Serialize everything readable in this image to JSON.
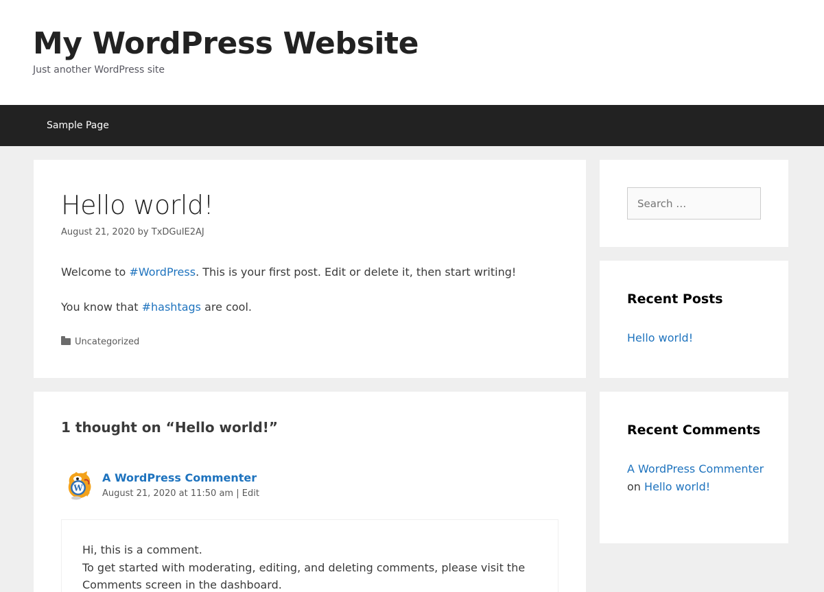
{
  "header": {
    "site_title": "My WordPress Website",
    "tagline": "Just another WordPress site"
  },
  "nav": {
    "items": [
      {
        "label": "Sample Page"
      }
    ]
  },
  "post": {
    "title": "Hello world!",
    "date": "August 21, 2020",
    "by": "by",
    "author": "TxDGuIE2AJ",
    "p1_link": "#WordPress",
    "p1_text": ". This is your first post. Edit or delete it, then start writing!",
    "p1_prefix": "Welcome to ",
    "p2_prefix": "You know that ",
    "p2_link": "#hashtags",
    "p2_suffix": " are cool.",
    "category": "Uncategorized",
    "category_icon": "folder-icon"
  },
  "comments": {
    "title": "1 thought on “Hello world!”",
    "items": [
      {
        "author": "A WordPress Commenter",
        "datetime": "August 21, 2020 at 11:50 am",
        "separator": "|",
        "edit_label": "Edit",
        "line1": "Hi, this is a comment.",
        "line2": "To get started with moderating, editing, and deleting comments, please visit the Comments screen in the dashboard."
      }
    ]
  },
  "sidebar": {
    "search_placeholder": "Search …",
    "recent_posts": {
      "title": "Recent Posts",
      "items": [
        {
          "label": "Hello world!"
        }
      ]
    },
    "recent_comments": {
      "title": "Recent Comments",
      "items": [
        {
          "author": "A WordPress Commenter",
          "on": "on",
          "post": "Hello world!"
        }
      ]
    }
  },
  "colors": {
    "link": "#1e73be",
    "nav_bg": "#222222",
    "page_bg": "#efefef"
  }
}
